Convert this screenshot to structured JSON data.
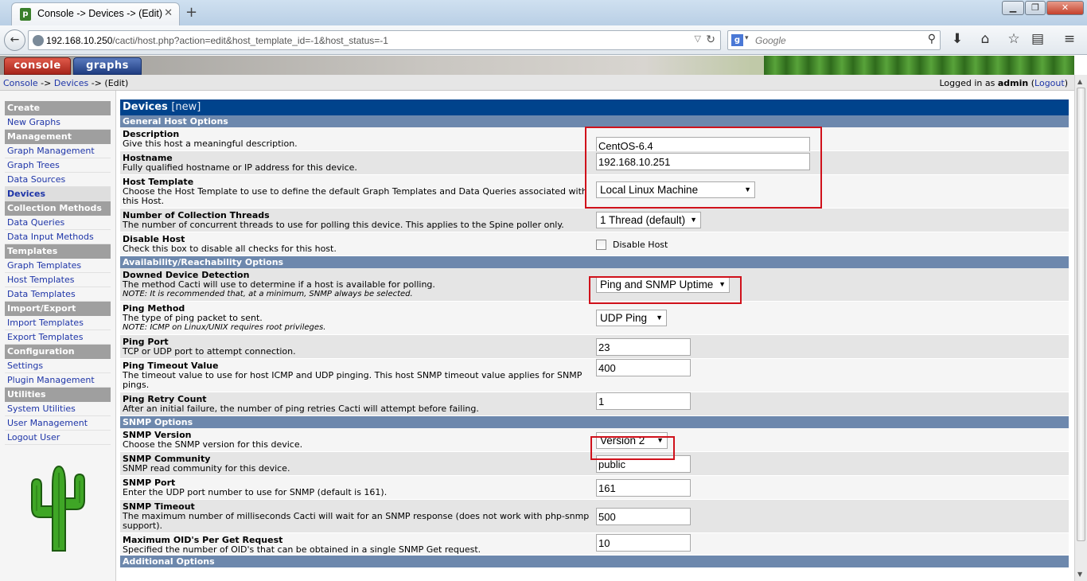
{
  "browser": {
    "tab_title": "Console -> Devices -> (Edit)",
    "url_host": "192.168.10.250",
    "url_path": "/cacti/host.php?action=edit&host_template_id=-1&host_status=-1",
    "search_placeholder": "Google",
    "favicon_letter": "p"
  },
  "header": {
    "tab_console": "console",
    "tab_graphs": "graphs"
  },
  "breadcrumb": {
    "console": "Console",
    "sep1": " -> ",
    "devices": "Devices",
    "sep2": " -> (Edit)",
    "logged_in_prefix": "Logged in as ",
    "user": "admin",
    "logout": "Logout"
  },
  "sidebar": {
    "items": [
      {
        "label": "Create",
        "type": "hdr"
      },
      {
        "label": "New Graphs",
        "type": "item"
      },
      {
        "label": "Management",
        "type": "hdr"
      },
      {
        "label": "Graph Management",
        "type": "item"
      },
      {
        "label": "Graph Trees",
        "type": "item"
      },
      {
        "label": "Data Sources",
        "type": "item"
      },
      {
        "label": "Devices",
        "type": "item",
        "active": true
      },
      {
        "label": "Collection Methods",
        "type": "hdr"
      },
      {
        "label": "Data Queries",
        "type": "item"
      },
      {
        "label": "Data Input Methods",
        "type": "item"
      },
      {
        "label": "Templates",
        "type": "hdr"
      },
      {
        "label": "Graph Templates",
        "type": "item"
      },
      {
        "label": "Host Templates",
        "type": "item"
      },
      {
        "label": "Data Templates",
        "type": "item"
      },
      {
        "label": "Import/Export",
        "type": "hdr"
      },
      {
        "label": "Import Templates",
        "type": "item"
      },
      {
        "label": "Export Templates",
        "type": "item"
      },
      {
        "label": "Configuration",
        "type": "hdr"
      },
      {
        "label": "Settings",
        "type": "item"
      },
      {
        "label": "Plugin Management",
        "type": "item"
      },
      {
        "label": "Utilities",
        "type": "hdr"
      },
      {
        "label": "System Utilities",
        "type": "item"
      },
      {
        "label": "User Management",
        "type": "item"
      },
      {
        "label": "Logout User",
        "type": "item"
      }
    ]
  },
  "panel": {
    "title": "Devices",
    "title_suffix": "[new]"
  },
  "sections": {
    "general": "General Host Options",
    "availability": "Availability/Reachability Options",
    "snmp": "SNMP Options",
    "additional": "Additional Options"
  },
  "fields": {
    "description": {
      "label": "Description",
      "help": "Give this host a meaningful description.",
      "value": "CentOS-6.4"
    },
    "hostname": {
      "label": "Hostname",
      "help": "Fully qualified hostname or IP address for this device.",
      "value": "192.168.10.251"
    },
    "host_template": {
      "label": "Host Template",
      "help": "Choose the Host Template to use to define the default Graph Templates and Data Queries associated with this Host.",
      "value": "Local Linux Machine"
    },
    "threads": {
      "label": "Number of Collection Threads",
      "help": "The number of concurrent threads to use for polling this device. This applies to the Spine poller only.",
      "value": "1 Thread (default)"
    },
    "disable_host": {
      "label": "Disable Host",
      "help": "Check this box to disable all checks for this host.",
      "checkbox_label": "Disable Host"
    },
    "downed_detection": {
      "label": "Downed Device Detection",
      "help": "The method Cacti will use to determine if a host is available for polling.",
      "note": "NOTE: It is recommended that, at a minimum, SNMP always be selected.",
      "value": "Ping and SNMP Uptime"
    },
    "ping_method": {
      "label": "Ping Method",
      "help": "The type of ping packet to sent.",
      "note": "NOTE: ICMP on Linux/UNIX requires root privileges.",
      "value": "UDP Ping"
    },
    "ping_port": {
      "label": "Ping Port",
      "help": "TCP or UDP port to attempt connection.",
      "value": "23"
    },
    "ping_timeout": {
      "label": "Ping Timeout Value",
      "help": "The timeout value to use for host ICMP and UDP pinging. This host SNMP timeout value applies for SNMP pings.",
      "value": "400"
    },
    "ping_retry": {
      "label": "Ping Retry Count",
      "help": "After an initial failure, the number of ping retries Cacti will attempt before failing.",
      "value": "1"
    },
    "snmp_version": {
      "label": "SNMP Version",
      "help": "Choose the SNMP version for this device.",
      "value": "Version 2"
    },
    "snmp_community": {
      "label": "SNMP Community",
      "help": "SNMP read community for this device.",
      "value": "public"
    },
    "snmp_port": {
      "label": "SNMP Port",
      "help": "Enter the UDP port number to use for SNMP (default is 161).",
      "value": "161"
    },
    "snmp_timeout": {
      "label": "SNMP Timeout",
      "help": "The maximum number of milliseconds Cacti will wait for an SNMP response (does not work with php-snmp support).",
      "value": "500"
    },
    "max_oids": {
      "label": "Maximum OID's Per Get Request",
      "help": "Specified the number of OID's that can be obtained in a single SNMP Get request.",
      "value": "10"
    }
  },
  "icons": {
    "back": "back-arrow-icon",
    "reload": "reload-icon",
    "search": "magnifier-icon",
    "download": "download-icon",
    "home": "home-icon",
    "bookmark": "star-icon",
    "library": "clipboard-icon",
    "menu": "hamburger-menu-icon",
    "logo": "cactus-logo-icon"
  },
  "colors": {
    "panel_title_bg": "#00438c",
    "section_bg": "#6d88ad",
    "highlight_box": "#d0111b",
    "link": "#1e35a8"
  }
}
